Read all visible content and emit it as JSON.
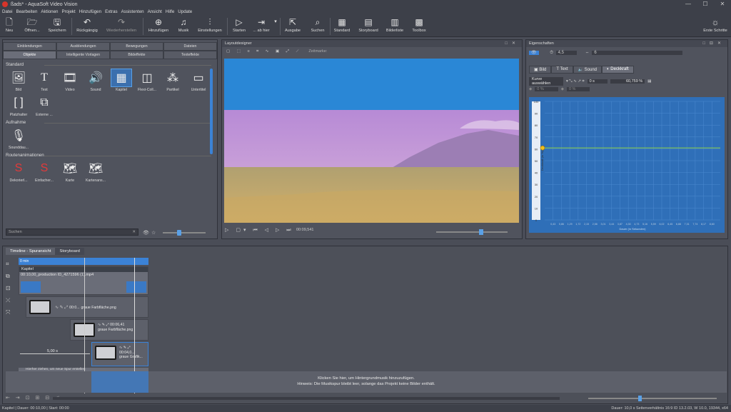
{
  "window": {
    "title": "ßads* - AquaSoft Video Vision",
    "controls": [
      "—",
      "☐",
      "✕"
    ]
  },
  "menu": [
    "Datei",
    "Bearbeiten",
    "Aktionen",
    "Projekt",
    "Hinzufügen",
    "Extras",
    "Assistenten",
    "Ansicht",
    "Hilfe",
    "Update"
  ],
  "toolbar": {
    "neu": "Neu",
    "oeffnen": "Öffnen...",
    "speichern": "Speichern",
    "rueck": "Rückgängig",
    "wieder": "Wiederherstellen",
    "hinzu": "Hinzufügen",
    "musik": "Musik",
    "einst": "Einstellungen",
    "starten": "Starten",
    "abhier": "... ab hier",
    "ausgabe": "Ausgabe",
    "suchen": "Suchen",
    "standard": "Standard",
    "storyboard": "Storyboard",
    "bildliste": "Bilderliste",
    "toolbox": "Toolbox",
    "ersteschritte": "Erste Schritte"
  },
  "left": {
    "tabs1": [
      "Einblendungen",
      "Ausblendungen",
      "Bewegungen",
      "Dateien"
    ],
    "tabs2": [
      "Objekte",
      "Intelligente Vorlagen",
      "Bildeffekte",
      "Texteffekte"
    ],
    "s1": "Standard",
    "items1": [
      "Bild",
      "Text",
      "Video",
      "Sound",
      "Kapitel",
      "Flexi-Coll...",
      "Partikel",
      "Untertitel"
    ],
    "items1b": [
      "Platzhalter",
      "Externe ..."
    ],
    "s2": "Aufnahme",
    "items2": [
      "Sounddau..."
    ],
    "s3": "Routenanimationen",
    "items3": [
      "Dekorierl...",
      "Einfacher...",
      "Karte",
      "Kartenans..."
    ],
    "search": "Suchen"
  },
  "preview": {
    "title": "Layoutdesigner",
    "zeitmarke": "Zeitmarke:",
    "time": "00:09,541"
  },
  "edit": {
    "title": "Eigenschaften",
    "tabs": [
      "Bild",
      "Text",
      "Sound",
      "Deckkraft"
    ],
    "kurve": "Kurve auswählen",
    "val1": "4,5",
    "val2": "6",
    "opac": "60,759 %",
    "zero": "0 s",
    "pct1": "0 %",
    "pct2": "0 %",
    "ylabel": "Deckkraft (in %)",
    "xlabel": "Dauer (in Sekunden)",
    "yticks": [
      "100",
      "90",
      "80",
      "70",
      "60",
      "50",
      "40",
      "30",
      "20",
      "10",
      "0"
    ],
    "xticks": [
      "0,43",
      "0,86",
      "1,29",
      "1,72",
      "2,15",
      "2,58",
      "3,01",
      "3,44",
      "3,87",
      "4,30",
      "4,73",
      "5,16",
      "5,59",
      "6,02",
      "6,45",
      "6,88",
      "7,31",
      "7,74",
      "8,17",
      "8,60"
    ]
  },
  "timeline": {
    "tabs": [
      "Timeline - Spuransicht",
      "Storyboard"
    ],
    "ruler": "0 min",
    "chapter": "Kapitel",
    "file": "00:10,00_production ID_4271596 (1).mp4",
    "clip1": "graue Farbfläche.png",
    "clip1t": "00:0...",
    "clip2t": "00:06,41",
    "clip2": "graue Farbfläche.png",
    "clip3t": "00:04,0...",
    "clip3": "graue Grafik...",
    "dur": "5,00 s",
    "hint": "Hierher ziehen, um neue Spur erstellen",
    "music1": "Klicken Sie hier, um Hintergrundmusik hinzuzufügen.",
    "music2": "Hinweis: Die Musikspur bleibt leer, solange das Projekt keine Bilder enthält."
  },
  "status": {
    "left": "Kapitel | Dauer: 00:10,00 | Start: 00:00",
    "right": "Dauer: 10,0 s    Seitenverhältnis 16:9    ID 13.2.03, W 10.0, 19344, x64"
  },
  "colors": {
    "accent": "#3b82d6",
    "sky": "#2a87d6"
  }
}
